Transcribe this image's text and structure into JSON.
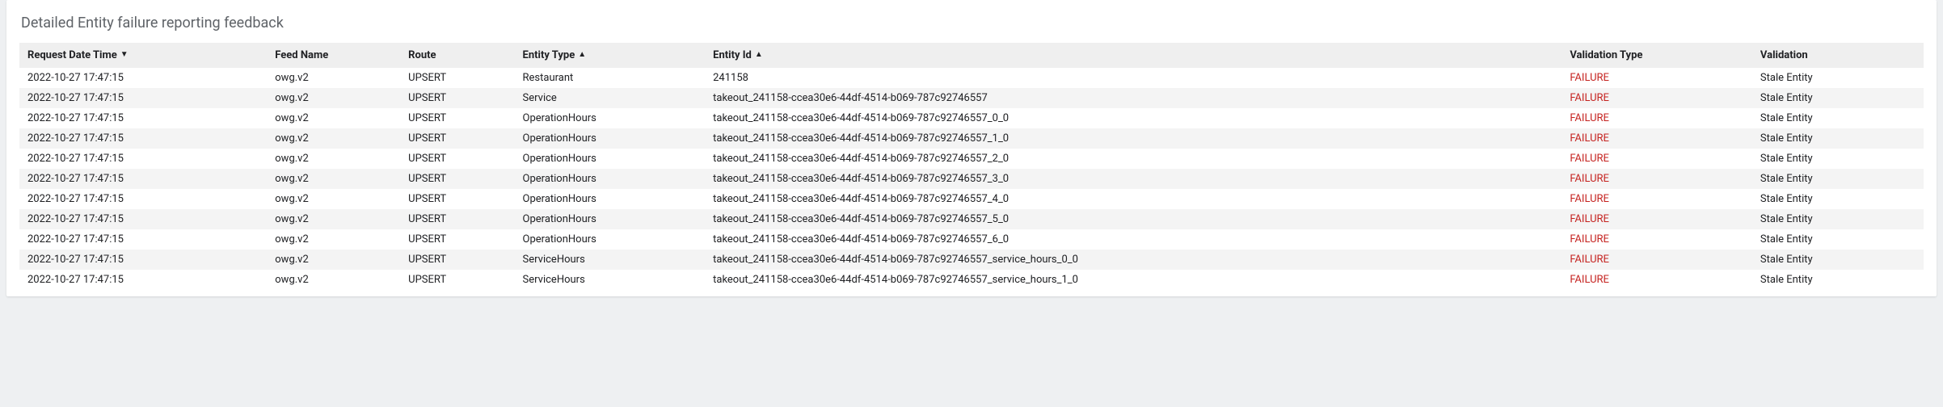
{
  "title": "Detailed Entity failure reporting feedback",
  "columns": [
    {
      "key": "request_dt",
      "label": "Request Date Time",
      "sort": "desc",
      "class": "col-datetime"
    },
    {
      "key": "feed_name",
      "label": "Feed Name",
      "sort": null,
      "class": "col-feed"
    },
    {
      "key": "route",
      "label": "Route",
      "sort": null,
      "class": "col-route"
    },
    {
      "key": "entity_type",
      "label": "Entity Type",
      "sort": "asc",
      "class": "col-etype"
    },
    {
      "key": "entity_id",
      "label": "Entity Id",
      "sort": "asc",
      "class": "col-eid"
    },
    {
      "key": "val_type",
      "label": "Validation Type",
      "sort": null,
      "class": "col-vtype"
    },
    {
      "key": "validation",
      "label": "Validation",
      "sort": null,
      "class": "col-val"
    }
  ],
  "failure_color": "#c5221f",
  "rows": [
    {
      "request_dt": "2022-10-27 17:47:15",
      "feed_name": "owg.v2",
      "route": "UPSERT",
      "entity_type": "Restaurant",
      "entity_id": "241158",
      "val_type": "FAILURE",
      "validation": "Stale Entity"
    },
    {
      "request_dt": "2022-10-27 17:47:15",
      "feed_name": "owg.v2",
      "route": "UPSERT",
      "entity_type": "Service",
      "entity_id": "takeout_241158-ccea30e6-44df-4514-b069-787c92746557",
      "val_type": "FAILURE",
      "validation": "Stale Entity"
    },
    {
      "request_dt": "2022-10-27 17:47:15",
      "feed_name": "owg.v2",
      "route": "UPSERT",
      "entity_type": "OperationHours",
      "entity_id": "takeout_241158-ccea30e6-44df-4514-b069-787c92746557_0_0",
      "val_type": "FAILURE",
      "validation": "Stale Entity"
    },
    {
      "request_dt": "2022-10-27 17:47:15",
      "feed_name": "owg.v2",
      "route": "UPSERT",
      "entity_type": "OperationHours",
      "entity_id": "takeout_241158-ccea30e6-44df-4514-b069-787c92746557_1_0",
      "val_type": "FAILURE",
      "validation": "Stale Entity"
    },
    {
      "request_dt": "2022-10-27 17:47:15",
      "feed_name": "owg.v2",
      "route": "UPSERT",
      "entity_type": "OperationHours",
      "entity_id": "takeout_241158-ccea30e6-44df-4514-b069-787c92746557_2_0",
      "val_type": "FAILURE",
      "validation": "Stale Entity"
    },
    {
      "request_dt": "2022-10-27 17:47:15",
      "feed_name": "owg.v2",
      "route": "UPSERT",
      "entity_type": "OperationHours",
      "entity_id": "takeout_241158-ccea30e6-44df-4514-b069-787c92746557_3_0",
      "val_type": "FAILURE",
      "validation": "Stale Entity"
    },
    {
      "request_dt": "2022-10-27 17:47:15",
      "feed_name": "owg.v2",
      "route": "UPSERT",
      "entity_type": "OperationHours",
      "entity_id": "takeout_241158-ccea30e6-44df-4514-b069-787c92746557_4_0",
      "val_type": "FAILURE",
      "validation": "Stale Entity"
    },
    {
      "request_dt": "2022-10-27 17:47:15",
      "feed_name": "owg.v2",
      "route": "UPSERT",
      "entity_type": "OperationHours",
      "entity_id": "takeout_241158-ccea30e6-44df-4514-b069-787c92746557_5_0",
      "val_type": "FAILURE",
      "validation": "Stale Entity"
    },
    {
      "request_dt": "2022-10-27 17:47:15",
      "feed_name": "owg.v2",
      "route": "UPSERT",
      "entity_type": "OperationHours",
      "entity_id": "takeout_241158-ccea30e6-44df-4514-b069-787c92746557_6_0",
      "val_type": "FAILURE",
      "validation": "Stale Entity"
    },
    {
      "request_dt": "2022-10-27 17:47:15",
      "feed_name": "owg.v2",
      "route": "UPSERT",
      "entity_type": "ServiceHours",
      "entity_id": "takeout_241158-ccea30e6-44df-4514-b069-787c92746557_service_hours_0_0",
      "val_type": "FAILURE",
      "validation": "Stale Entity"
    },
    {
      "request_dt": "2022-10-27 17:47:15",
      "feed_name": "owg.v2",
      "route": "UPSERT",
      "entity_type": "ServiceHours",
      "entity_id": "takeout_241158-ccea30e6-44df-4514-b069-787c92746557_service_hours_1_0",
      "val_type": "FAILURE",
      "validation": "Stale Entity"
    }
  ]
}
